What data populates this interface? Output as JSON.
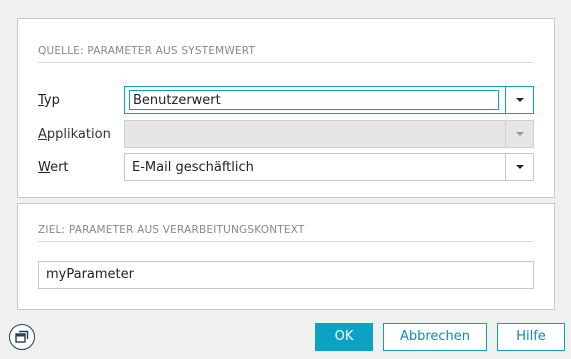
{
  "source": {
    "title": "QUELLE: PARAMETER AUS SYSTEMWERT",
    "type_label": "Typ",
    "type_value": "Benutzerwert",
    "application_label": "Applikation",
    "application_value": "",
    "value_label": "Wert",
    "value_value": "E-Mail geschäftlich"
  },
  "target": {
    "title": "ZIEL: PARAMETER AUS VERARBEITUNGSKONTEXT",
    "parameter_value": "myParameter"
  },
  "footer": {
    "ok_label": "OK",
    "cancel_label": "Abbrechen",
    "help_label": "Hilfe",
    "window_icon": "window-restore-icon"
  },
  "colors": {
    "accent": "#0aa3c4"
  }
}
